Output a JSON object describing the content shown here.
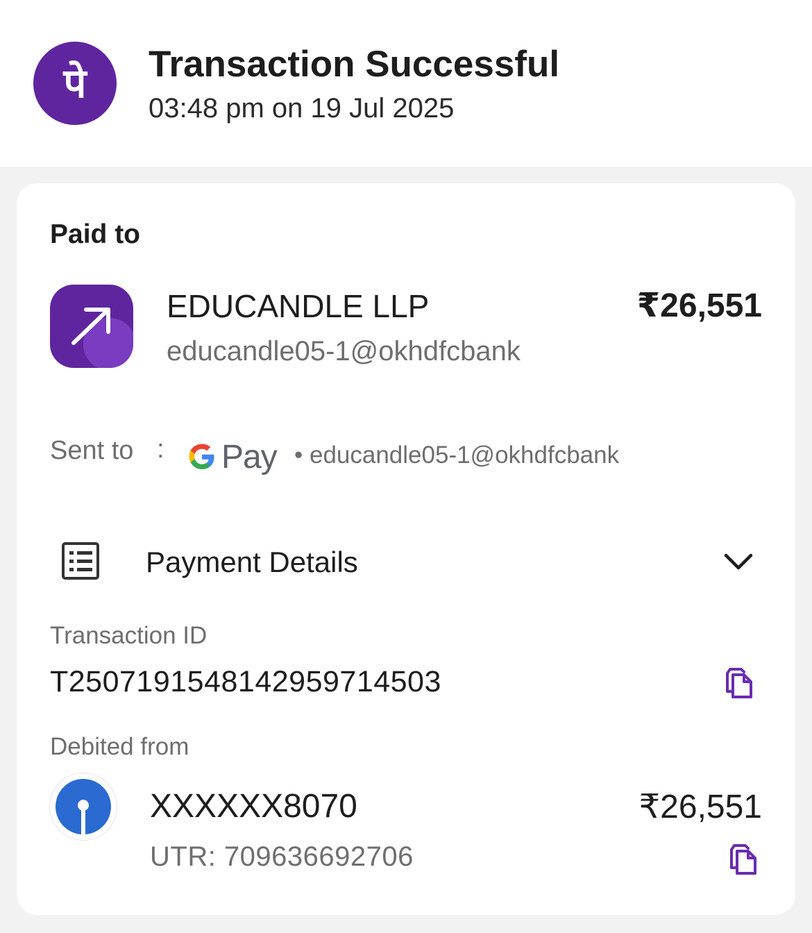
{
  "header": {
    "app_logo_icon": "phonepe-logo-icon",
    "app_logo_glyph": "पे",
    "title": "Transaction Successful",
    "timestamp": "03:48 pm on 19 Jul 2025"
  },
  "paid_to": {
    "section_label": "Paid to",
    "merchant_icon": "arrow-up-right-icon",
    "merchant_name": "EDUCANDLE LLP",
    "merchant_vpa": "educandle05-1@okhdfcbank",
    "amount": "₹26,551"
  },
  "sent_to": {
    "label": "Sent to",
    "separator": ":",
    "app_icon": "google-g-icon",
    "app_name": "Pay",
    "vpa": "• educandle05-1@okhdfcbank"
  },
  "payment_details": {
    "icon": "receipt-list-icon",
    "label": "Payment Details",
    "toggle_icon": "chevron-down-icon",
    "transaction_id_label": "Transaction ID",
    "transaction_id": "T2507191548142959714503",
    "debited_from_label": "Debited from",
    "bank_icon": "sbi-bank-icon",
    "account_number": "XXXXXX8070",
    "utr": "UTR: 709636692706",
    "amount": "₹26,551"
  },
  "colors": {
    "brand_purple": "#5f259f",
    "copy_icon": "#6a2bb0",
    "bank_blue": "#2a6ad1",
    "page_bg": "#f2f2f2",
    "card_bg": "#ffffff",
    "muted_text": "#6e6e6e"
  }
}
